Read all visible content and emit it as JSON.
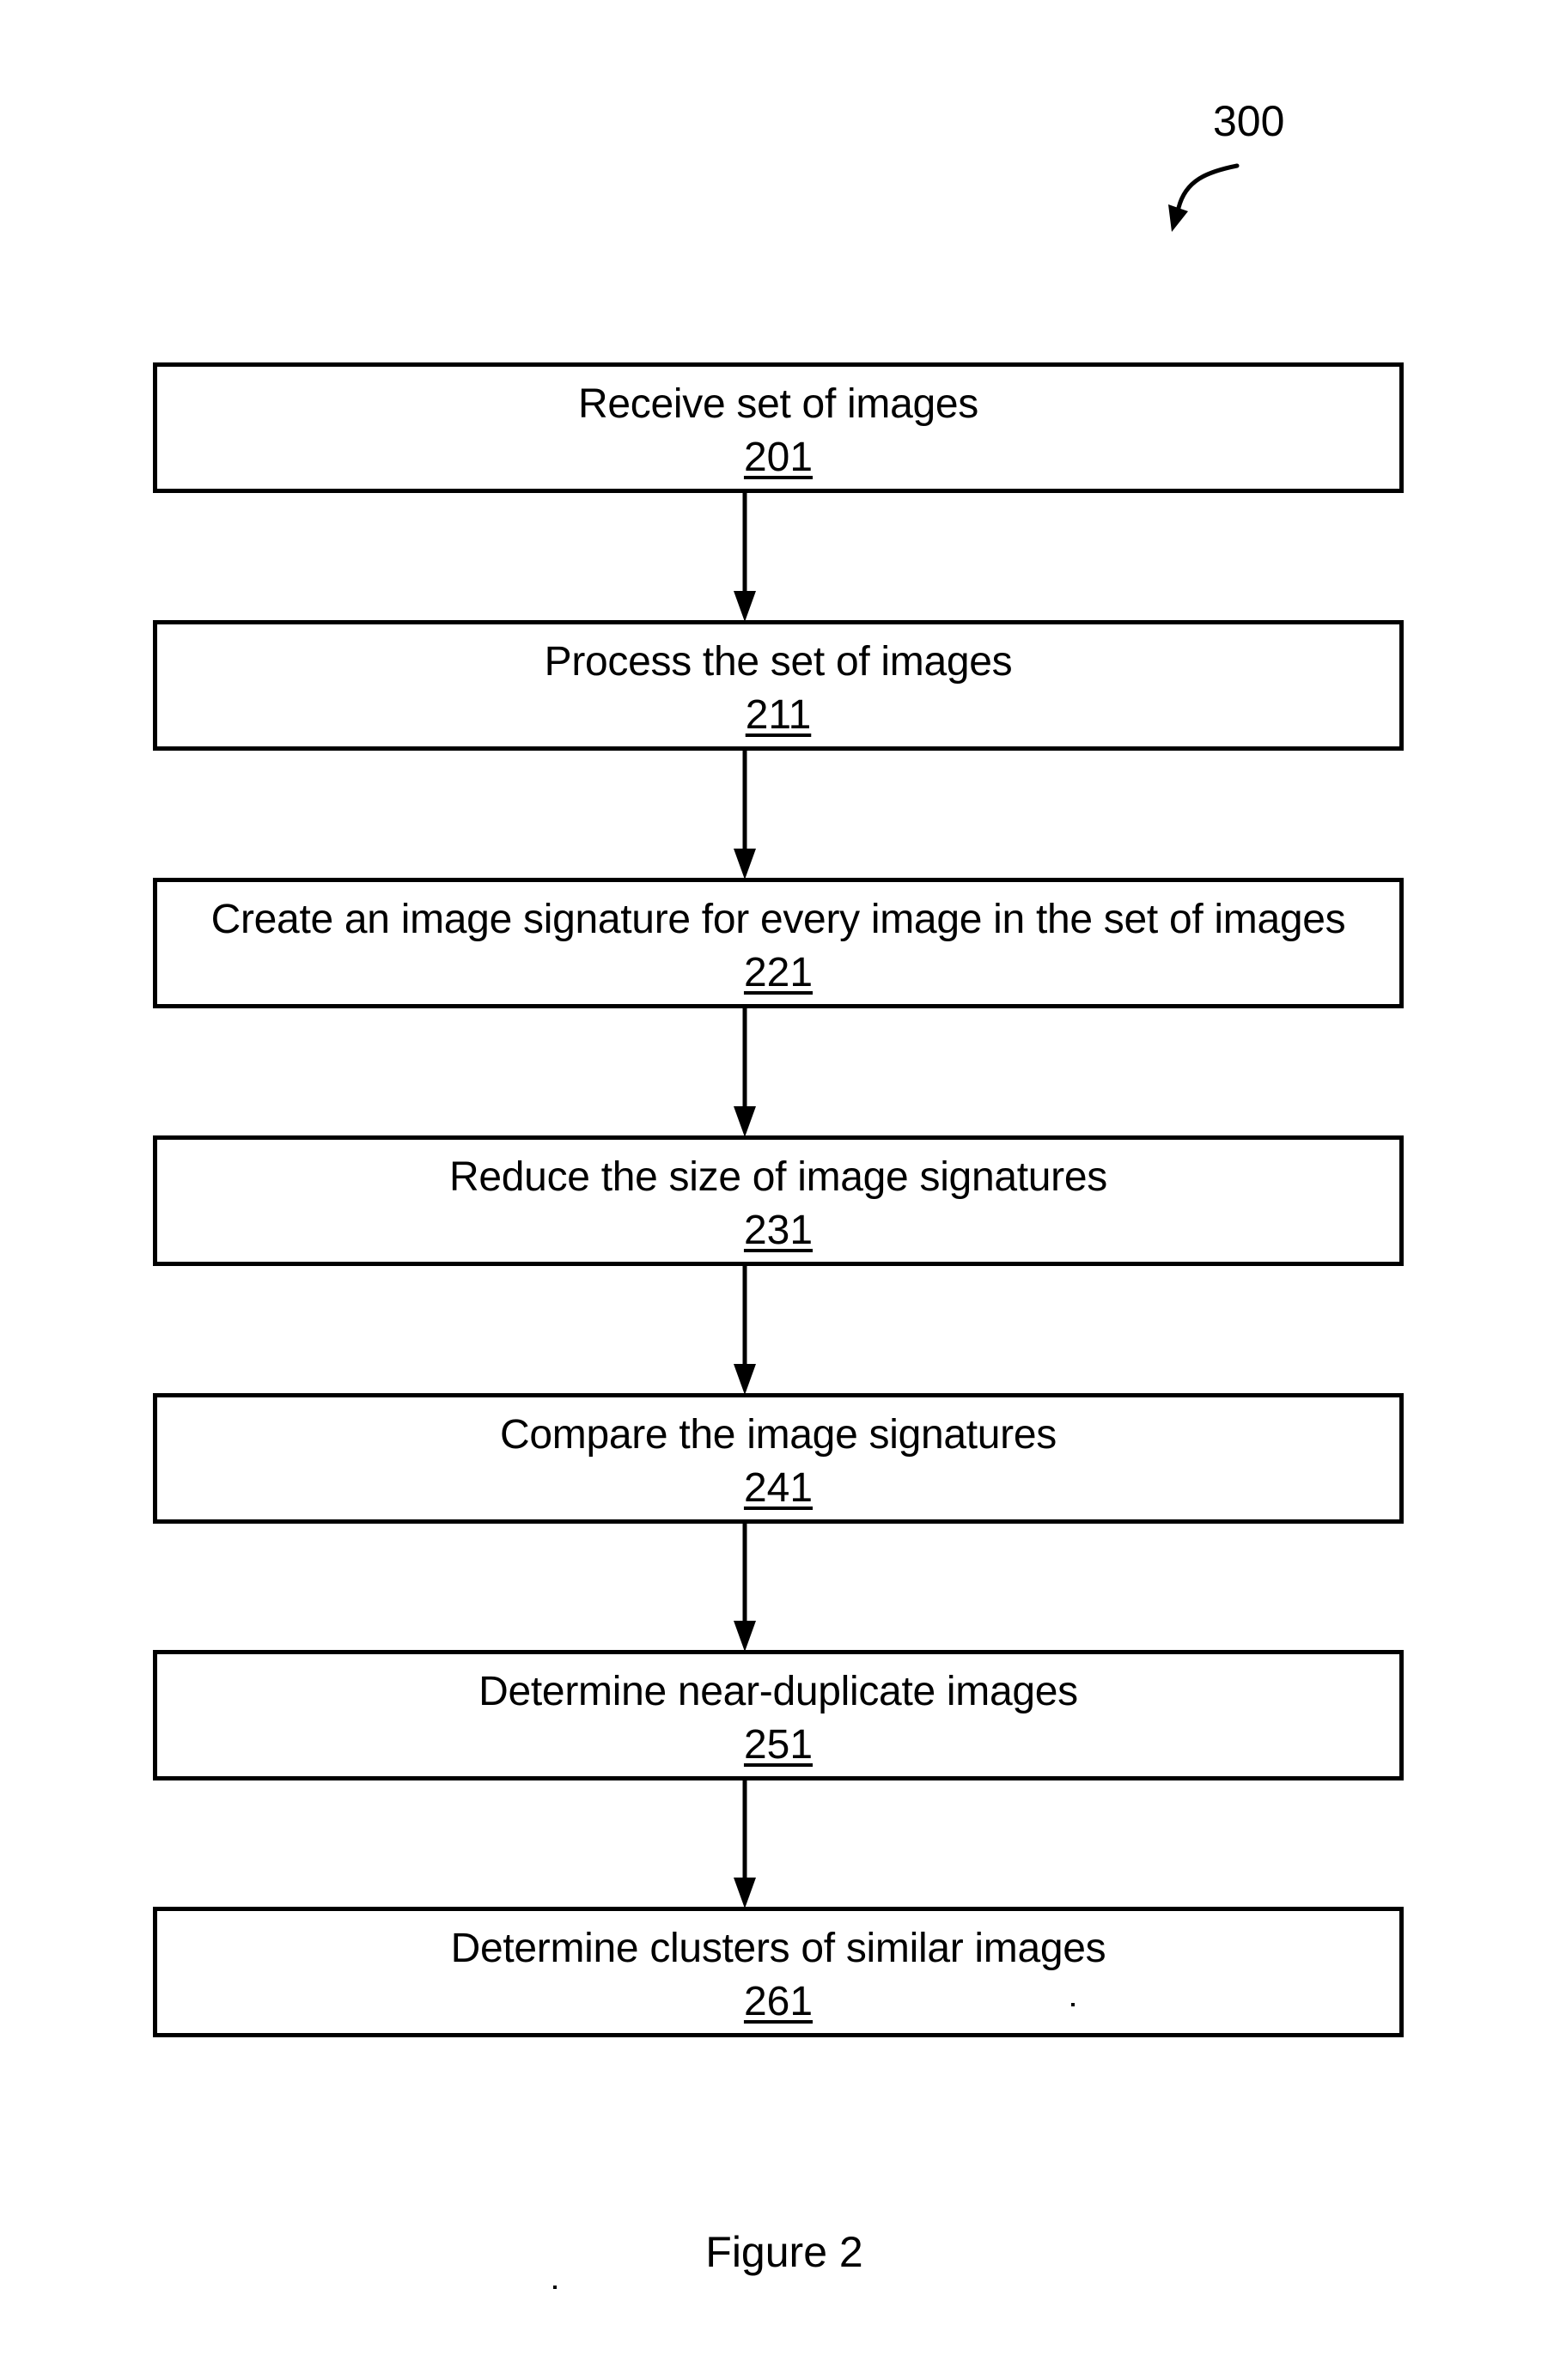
{
  "figure": {
    "reference_numeral": "300",
    "caption": "Figure 2"
  },
  "steps": [
    {
      "label": "Receive set of images",
      "number": "201"
    },
    {
      "label": "Process the set of images",
      "number": "211"
    },
    {
      "label": "Create an image signature for every image in the set of images",
      "number": "221"
    },
    {
      "label": "Reduce the size of image signatures",
      "number": "231"
    },
    {
      "label": "Compare the image signatures",
      "number": "241"
    },
    {
      "label": "Determine near-duplicate images",
      "number": "251"
    },
    {
      "label": "Determine clusters of similar images",
      "number": "261"
    }
  ],
  "connections": [
    {
      "from": "201",
      "to": "211"
    },
    {
      "from": "211",
      "to": "221"
    },
    {
      "from": "221",
      "to": "231"
    },
    {
      "from": "231",
      "to": "241"
    },
    {
      "from": "241",
      "to": "251"
    },
    {
      "from": "251",
      "to": "261"
    }
  ]
}
